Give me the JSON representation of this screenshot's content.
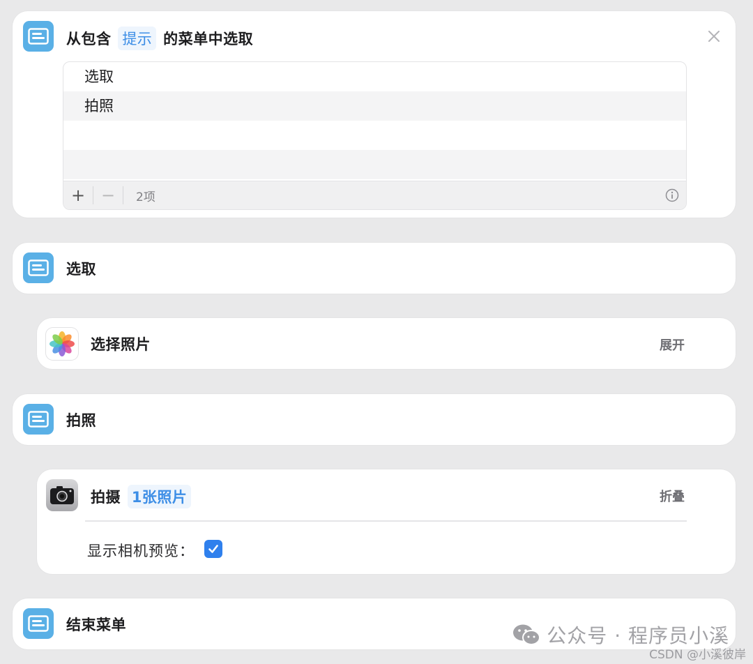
{
  "menu_action": {
    "title_prefix": "从包含",
    "title_token": "提示",
    "title_suffix": "的菜单中选取",
    "items": [
      "选取",
      "拍照",
      "",
      ""
    ],
    "item_count": "2项",
    "add_label": "+",
    "remove_label": "−"
  },
  "case_choose": {
    "title": "选取"
  },
  "select_photos": {
    "title": "选择照片",
    "toggle_label": "展开"
  },
  "case_photo": {
    "title": "拍照"
  },
  "take_photo": {
    "title": "拍摄",
    "token": "1张照片",
    "toggle_label": "折叠",
    "preview_label": "显示相机预览：",
    "preview_checked": true
  },
  "end_menu": {
    "title": "结束菜单"
  },
  "watermark": {
    "main": "公众号 · 程序员小溪",
    "sub": "CSDN @小溪彼岸"
  },
  "colors": {
    "accent": "#3d8ee6",
    "menu_icon": "#5ab0e6",
    "checkbox": "#2f80ed",
    "background": "#e9e9ea"
  }
}
